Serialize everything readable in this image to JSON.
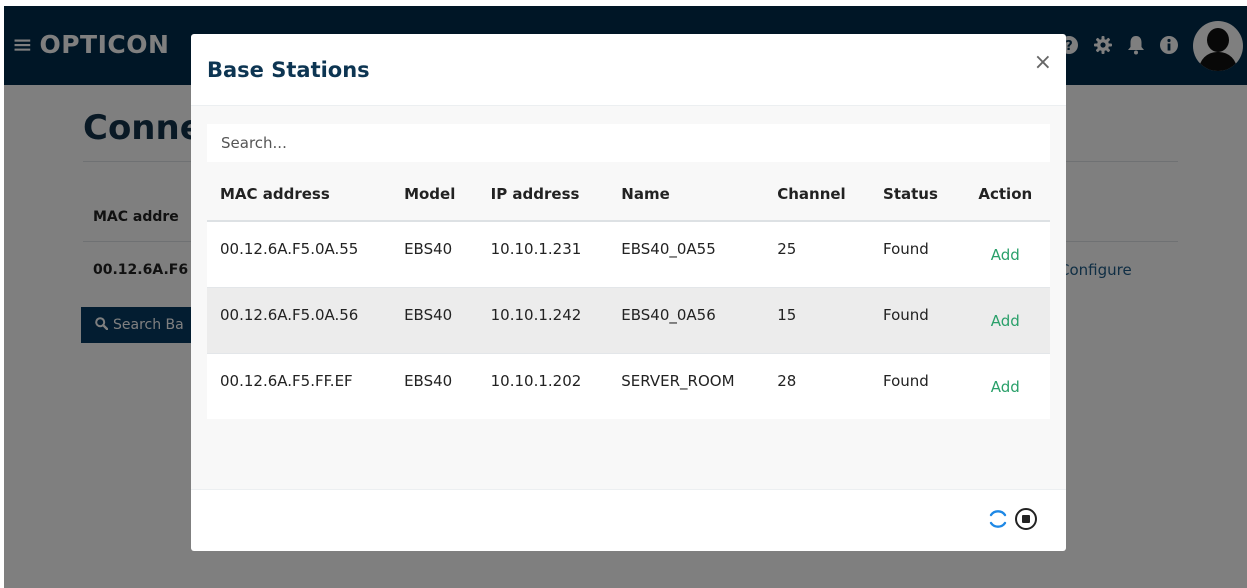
{
  "app": {
    "brand": "OPTICON",
    "menu_glyph": "≡"
  },
  "nav": {
    "icons": [
      "help-icon",
      "gear-icon",
      "bell-icon",
      "info-icon",
      "user-avatar-icon"
    ]
  },
  "background_page": {
    "title": "Conne",
    "column_header": "MAC addre",
    "cell": "00.12.6A.F6",
    "configure_link": "Configure",
    "search_button_label": "Search Ba"
  },
  "modal": {
    "title": "Base Stations",
    "close_glyph": "×",
    "search_placeholder": "Search...",
    "columns": [
      "MAC address",
      "Model",
      "IP address",
      "Name",
      "Channel",
      "Status",
      "Action"
    ],
    "rows": [
      {
        "mac": "00.12.6A.F5.0A.55",
        "model": "EBS40",
        "ip": "10.10.1.231",
        "name": "EBS40_0A55",
        "channel": "25",
        "status": "Found",
        "action": "Add"
      },
      {
        "mac": "00.12.6A.F5.0A.56",
        "model": "EBS40",
        "ip": "10.10.1.242",
        "name": "EBS40_0A56",
        "channel": "15",
        "status": "Found",
        "action": "Add"
      },
      {
        "mac": "00.12.6A.F5.FF.EF",
        "model": "EBS40",
        "ip": "10.10.1.202",
        "name": "SERVER_ROOM",
        "channel": "28",
        "status": "Found",
        "action": "Add"
      }
    ],
    "footer_icons": [
      "loading-spinner-icon",
      "stop-icon"
    ]
  },
  "colors": {
    "navbar": "#002d4d",
    "title": "#0d3552",
    "action_link": "#2aa06a",
    "spinner": "#1e88e5"
  }
}
